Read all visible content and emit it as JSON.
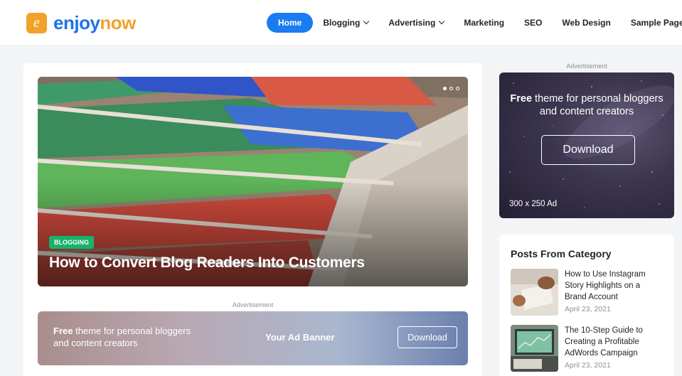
{
  "brand": {
    "logo_letter": "e",
    "name_part1": "enjoy",
    "name_part2": "now"
  },
  "nav": {
    "items": [
      {
        "label": "Home",
        "active": true
      },
      {
        "label": "Blogging",
        "dropdown": true
      },
      {
        "label": "Advertising",
        "dropdown": true
      },
      {
        "label": "Marketing"
      },
      {
        "label": "SEO"
      },
      {
        "label": "Web Design"
      },
      {
        "label": "Sample Page"
      }
    ]
  },
  "hero": {
    "category": "Blogging",
    "title": "How to Convert Blog Readers Into Customers",
    "slides": 3,
    "active_slide": 1
  },
  "ad_label": "Advertisement",
  "banner": {
    "bold": "Free",
    "text_rest": " theme for personal bloggers",
    "text_line2": "and content creators",
    "center": "Your Ad Banner",
    "button": "Download"
  },
  "sidebar_ad": {
    "label": "Advertisement",
    "bold": "Free",
    "text_rest": " theme for personal bloggers",
    "text_line2": "and content creators",
    "button": "Download",
    "size": "300 x 250 Ad"
  },
  "widget": {
    "title": "Posts From Category",
    "posts": [
      {
        "title": "How to Use Instagram Story Highlights on a Brand Account",
        "date": "April 23, 2021"
      },
      {
        "title": "The 10-Step Guide to Creating a Profitable AdWords Campaign",
        "date": "April 23, 2021"
      }
    ]
  },
  "colors": {
    "accent": "#1a7cf1",
    "logo": "#f2a12b",
    "badge": "#18b26b"
  }
}
